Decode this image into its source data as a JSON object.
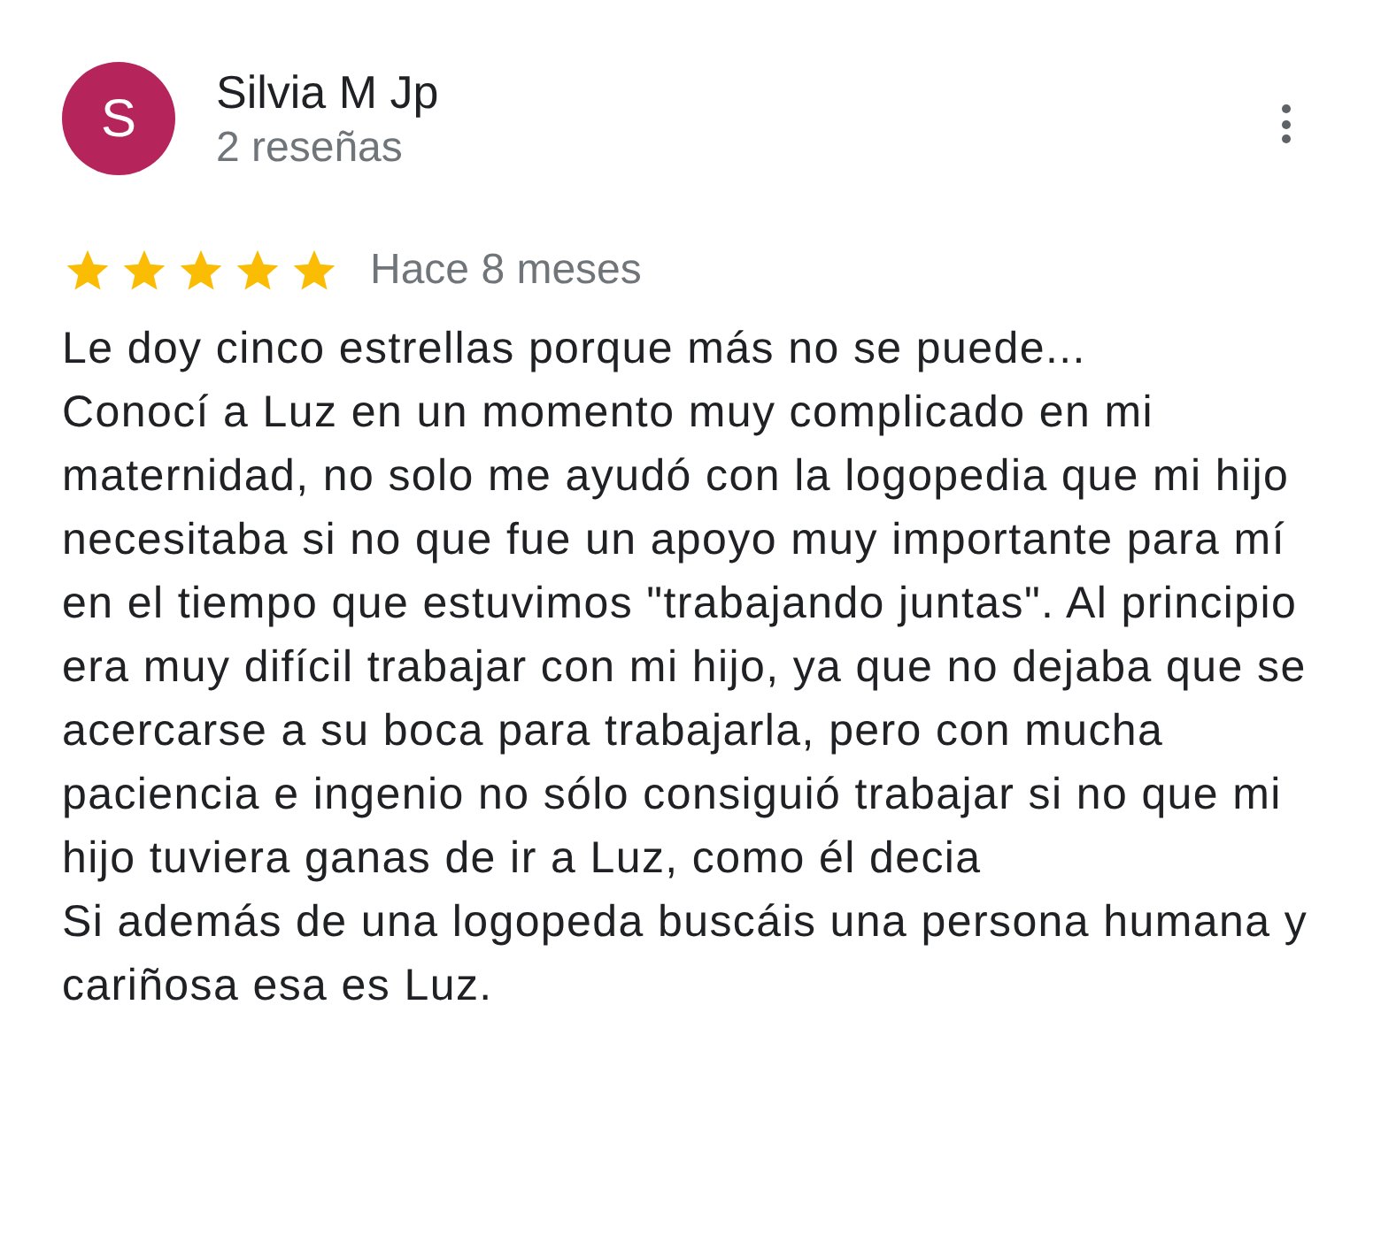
{
  "review": {
    "avatar_letter": "S",
    "color": "#b5245a",
    "author": "Silvia M Jp",
    "reviews_count": "2 reseñas",
    "stars": 5,
    "time": "Hace 8 meses",
    "paragraphs": [
      "Le doy cinco estrellas porque más no se puede...",
      "Conocí a Luz en un momento muy complicado en mi maternidad, no solo me ayudó con la logopedia que mi hijo necesitaba si no que fue un apoyo muy importante para mí en el tiempo que estuvimos \"trabajando juntas\". Al principio era muy difícil trabajar con mi hijo, ya que no dejaba que se acercarse a su boca para trabajarla, pero con mucha paciencia e ingenio no sólo consiguió trabajar si no que mi hijo tuviera ganas de ir a Luz, como él decia",
      "Si además de una logopeda buscáis una persona humana y cariñosa esa es Luz."
    ]
  }
}
